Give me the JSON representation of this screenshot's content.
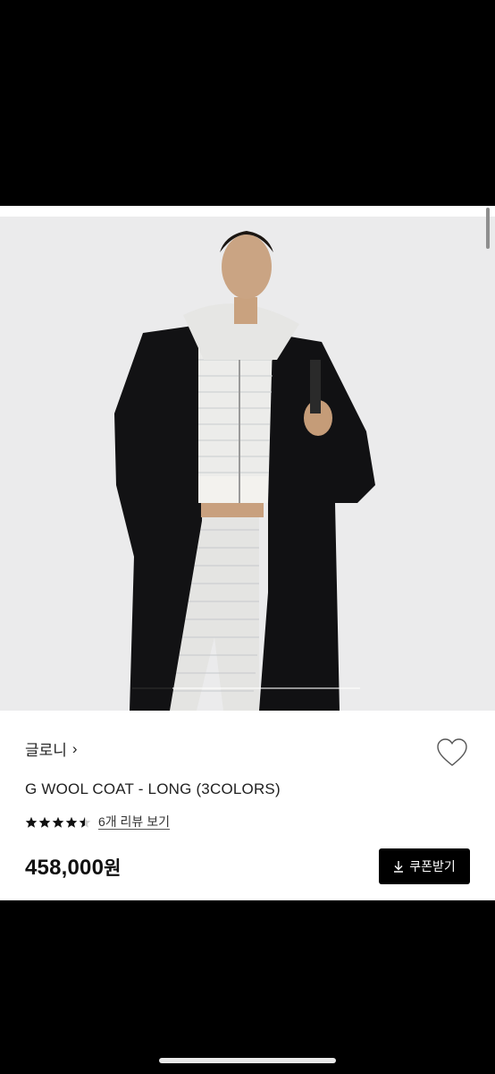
{
  "product": {
    "brand": "글로니",
    "brand_chevron": "›",
    "title": "G WOOL COAT - LONG (3COLORS)",
    "rating": 4.5,
    "rating_max": 5,
    "review_link": "6개 리뷰 보기",
    "price": "458,000",
    "currency": "원"
  },
  "coupon": {
    "label": "쿠폰받기",
    "icon": "download-icon"
  },
  "icons": {
    "wishlist": "heart-outline-icon",
    "star": "star-icon"
  },
  "carousel": {
    "current_index": 1,
    "progress": 0.18
  },
  "colors": {
    "button_bg": "#000000",
    "page_bg": "#ffffff",
    "text": "#222222"
  }
}
